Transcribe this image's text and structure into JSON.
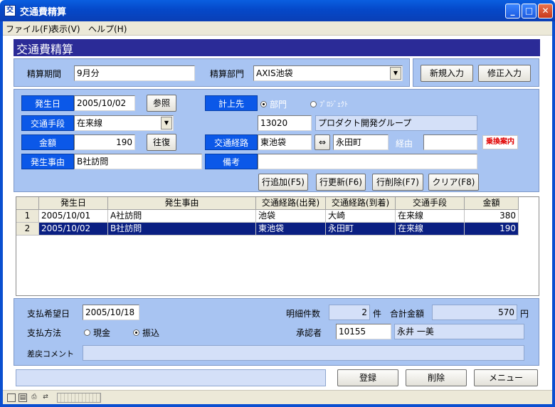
{
  "window": {
    "title": "交通費精算"
  },
  "menu": [
    "ファイル(F)",
    "表示(V)",
    "ヘルプ(H)"
  ],
  "header": {
    "title": "交通費精算"
  },
  "top": {
    "period_label": "精算期間",
    "period_value": "9月分",
    "dept_label": "精算部門",
    "dept_value": "AXIS池袋",
    "new_button": "新規入力",
    "edit_button": "修正入力"
  },
  "entry": {
    "date_label": "発生日",
    "date_value": "2005/10/02",
    "ref_button": "参照",
    "account_label": "計上先",
    "radio_dept": "部門",
    "radio_project": "ﾌﾟﾛｼﾞｪｸﾄ",
    "transport_label": "交通手段",
    "transport_value": "在来線",
    "code_value": "13020",
    "code_name": "プロダクト開発グループ",
    "amount_label": "金額",
    "amount_value": "190",
    "roundtrip_button": "往復",
    "route_label": "交通経路",
    "route_from": "東池袋",
    "swap_icon": "⇔",
    "route_to": "永田町",
    "via_label": "経由",
    "via_value": "",
    "transfer_link": "乗換案内",
    "reason_label": "発生事由",
    "reason_value": "B社訪問",
    "note_label": "備考",
    "note_value": "",
    "add_button": "行追加(F5)",
    "update_button": "行更新(F6)",
    "delete_row_button": "行削除(F7)",
    "clear_button": "クリア(F8)"
  },
  "table": {
    "columns": [
      "",
      "発生日",
      "発生事由",
      "交通経路(出発)",
      "交通経路(到着)",
      "交通手段",
      "金額"
    ],
    "rows": [
      [
        "1",
        "2005/10/01",
        "A社訪問",
        "池袋",
        "大崎",
        "在来線",
        "380"
      ],
      [
        "2",
        "2005/10/02",
        "B社訪問",
        "東池袋",
        "永田町",
        "在来線",
        "190"
      ]
    ]
  },
  "bottom": {
    "pay_date_label": "支払希望日",
    "pay_date_value": "2005/10/18",
    "count_label": "明細件数",
    "count_value": "2",
    "count_unit": "件",
    "total_label": "合計金額",
    "total_value": "570",
    "total_unit": "円",
    "pay_method_label": "支払方法",
    "cash_label": "現金",
    "transfer_label": "振込",
    "approver_label": "承認者",
    "approver_id": "10155",
    "approver_name": "永井 一美",
    "comment_label": "差戻コメント",
    "comment_value": ""
  },
  "footer": {
    "register_button": "登録",
    "delete_button": "削除",
    "menu_button": "メニュー"
  }
}
